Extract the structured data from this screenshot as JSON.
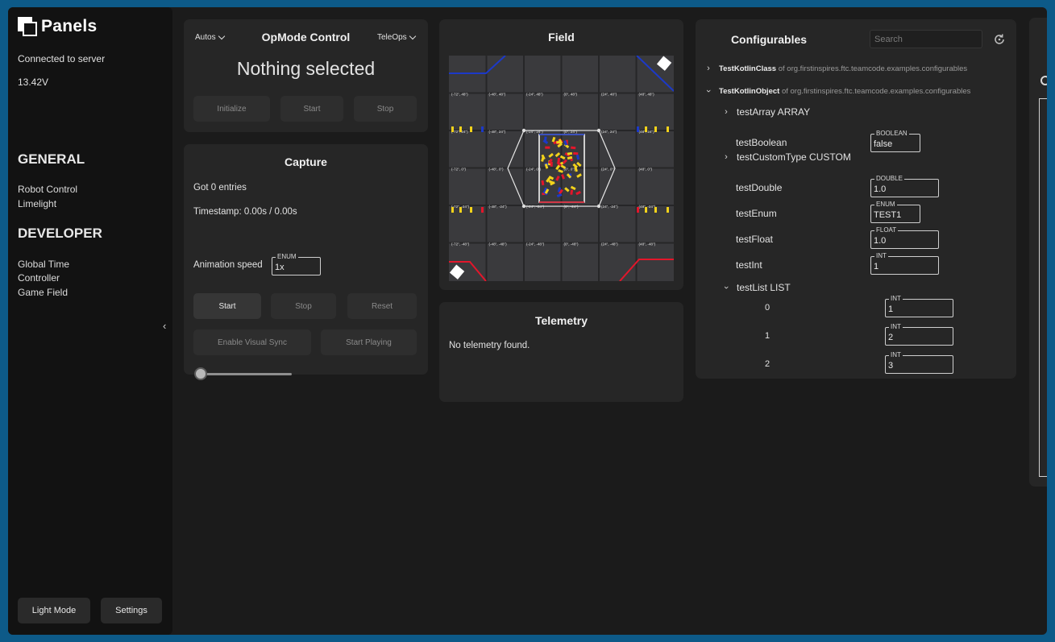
{
  "sidebar": {
    "brand": "Panels",
    "connection_status": "Connected to server",
    "voltage": "13.42V",
    "general_heading": "GENERAL",
    "general_items": [
      "Robot Control",
      "Limelight"
    ],
    "developer_heading": "DEVELOPER",
    "developer_items": [
      "Global Time",
      "Controller",
      "Game Field"
    ],
    "collapse_icon": "chevron-left-icon",
    "light_mode_label": "Light Mode",
    "settings_label": "Settings"
  },
  "opmode": {
    "autos_label": "Autos",
    "title": "OpMode Control",
    "teleops_label": "TeleOps",
    "selected": "Nothing selected",
    "initialize_label": "Initialize",
    "start_label": "Start",
    "stop_label": "Stop"
  },
  "capture": {
    "title": "Capture",
    "entries": "Got 0 entries",
    "timestamp": "Timestamp: 0.00s / 0.00s",
    "slider_value": 0,
    "animation_speed_label": "Animation speed",
    "speed_type": "ENUM",
    "speed_value": "1x",
    "start_label": "Start",
    "stop_label": "Stop",
    "reset_label": "Reset",
    "visual_sync_label": "Enable Visual Sync",
    "start_playing_label": "Start Playing"
  },
  "field": {
    "title": "Field",
    "coord_labels": [
      "(-72\", 48\")",
      "(-48\", 48\")",
      "(-24\", 48\")",
      "(0\", 48\")",
      "(24\", 48\")",
      "(48\", 48\")",
      "(-72\", 24\")",
      "(-48\", 24\")",
      "(-24\", 24\")",
      "(0\", 24\")",
      "(24\", 24\")",
      "(48\", 24\")",
      "(-72\", 0\")",
      "(-48\", 0\")",
      "(-24\", 0\")",
      "(0\", 0\")",
      "(24\", 0\")",
      "(48\", 0\")",
      "(-72\", -24\")",
      "(-48\", -24\")",
      "(-24\", -24\")",
      "(0\", -24\")",
      "(24\", -24\")",
      "(48\", -24\")",
      "(-72\", -48\")",
      "(-48\", -48\")",
      "(-24\", -48\")",
      "(0\", -48\")",
      "(24\", -48\")",
      "(48\", -48\")"
    ],
    "colors": {
      "tile": "#3a3a3d",
      "red": "#e3162b",
      "blue": "#1c39c8",
      "yellow": "#f2d21b"
    }
  },
  "telemetry": {
    "title": "Telemetry",
    "empty_text": "No telemetry found."
  },
  "configurables": {
    "title": "Configurables",
    "search_placeholder": "Search",
    "refresh_icon": "refresh-icon",
    "class1_name": "TestKotlinClass",
    "class1_pkg": " of org.firstinspires.ftc.teamcode.examples.configurables",
    "class2_name": "TestKotlinObject",
    "class2_pkg": " of org.firstinspires.ftc.teamcode.examples.configurables",
    "testArray": "testArray ARRAY",
    "testBoolean": "testBoolean",
    "testBoolean_type": "BOOLEAN",
    "testBoolean_value": "false",
    "testCustomType": "testCustomType CUSTOM",
    "testDouble": "testDouble",
    "testDouble_type": "DOUBLE",
    "testDouble_value": "1.0",
    "testEnum": "testEnum",
    "testEnum_type": "ENUM",
    "testEnum_value": "TEST1",
    "testFloat": "testFloat",
    "testFloat_type": "FLOAT",
    "testFloat_value": "1.0",
    "testInt": "testInt",
    "testInt_type": "INT",
    "testInt_value": "1",
    "testList": "testList LIST",
    "list_items": [
      {
        "index": "0",
        "type": "INT",
        "value": "1"
      },
      {
        "index": "1",
        "type": "INT",
        "value": "2"
      },
      {
        "index": "2",
        "type": "INT",
        "value": "3"
      }
    ]
  }
}
